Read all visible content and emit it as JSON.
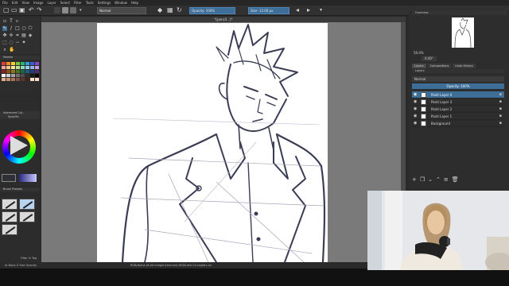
{
  "menu": [
    "File",
    "Edit",
    "View",
    "Image",
    "Layer",
    "Select",
    "Filter",
    "Tools",
    "Settings",
    "Window",
    "Help"
  ],
  "toolbar": {
    "blend_mode": "Normal",
    "opacity": "Opacity: 100%",
    "size": "Size: 13.00 px"
  },
  "canvas": {
    "doc_title": "*[pencil...]*"
  },
  "left": {
    "palette_title": "Palette",
    "adv_color_title": "Advanced Col...",
    "specific_title": "Specific",
    "brush_title": "Brush Presets",
    "filter_label": "Filter in Tag"
  },
  "swatches": [
    "#e23b3b",
    "#f08c2b",
    "#f2d12b",
    "#7fc341",
    "#2bb673",
    "#2ba3d9",
    "#3b5fd1",
    "#8b45c9",
    "#f2a0a0",
    "#f7c58a",
    "#f9ea98",
    "#bfe19b",
    "#93dbb8",
    "#93d0ec",
    "#9bb0ea",
    "#c5a3e5",
    "#8a2222",
    "#8a5119",
    "#8a781a",
    "#4b7227",
    "#1a6b44",
    "#1a5f80",
    "#233a7c",
    "#522977",
    "#ffffff",
    "#d0d0d0",
    "#a0a0a0",
    "#707070",
    "#505050",
    "#303030",
    "#181818",
    "#000000",
    "#e2b38c",
    "#c99270",
    "#a8735a",
    "#7d5442",
    "#58392d",
    "#3a261e",
    "#f5e0cc",
    "#ffd9c2"
  ],
  "status": {
    "left": "Ai Basic-5 Size Opacity",
    "center": "RGB/Alpha (8-bit integer/channel)  sRGB-elle-V2-srgbtrc.icc"
  },
  "right": {
    "overview_title": "Overview",
    "zoom": "56.0%",
    "rotation": "0.00°",
    "tabs": [
      "Layers",
      "Compositions",
      "Undo History"
    ],
    "layers_title": "Layers",
    "layer_mode": "Normal",
    "layer_opacity": "Opacity: 100%",
    "layers": [
      {
        "name": "Paint Layer 4",
        "selected": true
      },
      {
        "name": "Paint Layer 3",
        "selected": false
      },
      {
        "name": "Paint Layer 2",
        "selected": false
      },
      {
        "name": "Paint Layer 1",
        "selected": false
      },
      {
        "name": "Background",
        "selected": false
      }
    ]
  },
  "colors": {
    "accent": "#3d6e98",
    "panel": "#2d2d2d",
    "canvas_bg": "#7a7a7a"
  }
}
